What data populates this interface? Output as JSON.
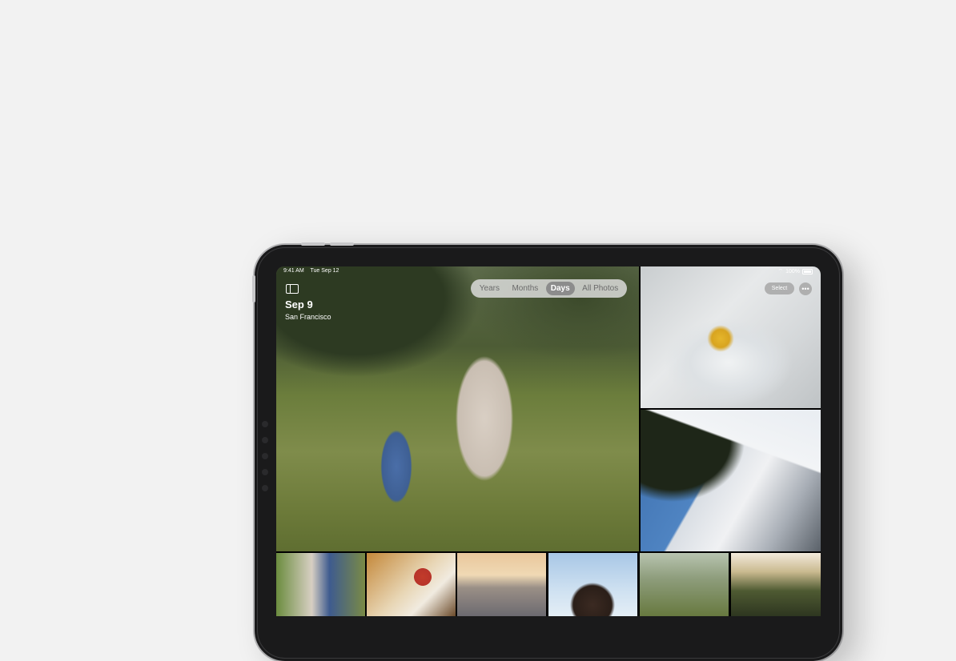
{
  "status_bar": {
    "time": "9:41 AM",
    "date": "Tue Sep 12",
    "battery": "100%",
    "wifi_icon": "wifi-icon",
    "battery_icon": "battery-icon"
  },
  "library": {
    "title": "Sep 9",
    "subtitle": "San Francisco",
    "view_tabs": [
      {
        "label": "Years",
        "active": false
      },
      {
        "label": "Months",
        "active": false
      },
      {
        "label": "Days",
        "active": true
      },
      {
        "label": "All Photos",
        "active": false
      }
    ],
    "select_label": "Select",
    "more_icon": "ellipsis-icon",
    "sidebar_icon": "sidebar-toggle-icon"
  },
  "colors": {
    "background": "#f2f2f2",
    "device_frame": "#1a1a1b",
    "segment_active": "#8c8c8c"
  }
}
